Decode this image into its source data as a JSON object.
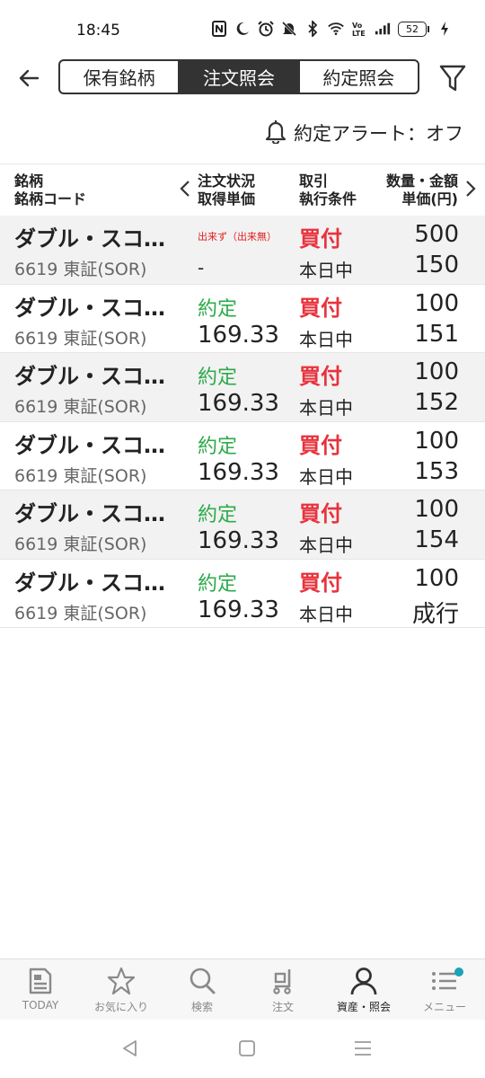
{
  "status_bar": {
    "time": "18:45",
    "battery": "52",
    "icons": [
      "nfc-icon",
      "moon-icon",
      "alarm-icon",
      "mute-icon",
      "bluetooth-icon",
      "wifi-icon",
      "volte-icon",
      "signal-icon",
      "battery-icon",
      "charging-icon"
    ]
  },
  "header": {
    "back_icon": "back-arrow-icon",
    "tabs": [
      {
        "label": "保有銘柄",
        "active": false
      },
      {
        "label": "注文照会",
        "active": true
      },
      {
        "label": "約定照会",
        "active": false
      }
    ],
    "filter_icon": "filter-icon"
  },
  "alert": {
    "icon": "bell-icon",
    "label": "約定アラート：オフ"
  },
  "table": {
    "headers": {
      "col1_line1": "銘柄",
      "col1_line2": "銘柄コード",
      "col2_line1": "注文状況",
      "col2_line2": "取得単価",
      "col3_line1": "取引",
      "col3_line2": "執行条件",
      "col4_line1": "数量・金額",
      "col4_line2": "単価(円)"
    },
    "rows": [
      {
        "name": "ダブル・スコ…",
        "code": "6619 東証(SOR)",
        "status": "出来ず（出来無）",
        "price": "-",
        "side": "買付",
        "condition": "本日中",
        "quantity": "500",
        "unit_price": "150"
      },
      {
        "name": "ダブル・スコ…",
        "code": "6619 東証(SOR)",
        "status": "約定",
        "price": "169.33",
        "side": "買付",
        "condition": "本日中",
        "quantity": "100",
        "unit_price": "151"
      },
      {
        "name": "ダブル・スコ…",
        "code": "6619 東証(SOR)",
        "status": "約定",
        "price": "169.33",
        "side": "買付",
        "condition": "本日中",
        "quantity": "100",
        "unit_price": "152"
      },
      {
        "name": "ダブル・スコ…",
        "code": "6619 東証(SOR)",
        "status": "約定",
        "price": "169.33",
        "side": "買付",
        "condition": "本日中",
        "quantity": "100",
        "unit_price": "153"
      },
      {
        "name": "ダブル・スコ…",
        "code": "6619 東証(SOR)",
        "status": "約定",
        "price": "169.33",
        "side": "買付",
        "condition": "本日中",
        "quantity": "100",
        "unit_price": "154"
      },
      {
        "name": "ダブル・スコ…",
        "code": "6619 東証(SOR)",
        "status": "約定",
        "price": "169.33",
        "side": "買付",
        "condition": "本日中",
        "quantity": "100",
        "unit_price": "成行"
      }
    ]
  },
  "bottom_nav": {
    "items": [
      {
        "label": "TODAY",
        "icon": "news-icon"
      },
      {
        "label": "お気に入り",
        "icon": "star-icon"
      },
      {
        "label": "検索",
        "icon": "search-icon"
      },
      {
        "label": "注文",
        "icon": "cart-icon"
      },
      {
        "label": "資産・照会",
        "icon": "person-icon"
      },
      {
        "label": "メニュー",
        "icon": "menu-icon"
      }
    ]
  },
  "colors": {
    "accent_dark": "#333333",
    "filled_green": "#2eaa4a",
    "buy_red": "#e8323c",
    "unfilled_red": "#e02020",
    "notification_dot": "#1aa3b8"
  }
}
